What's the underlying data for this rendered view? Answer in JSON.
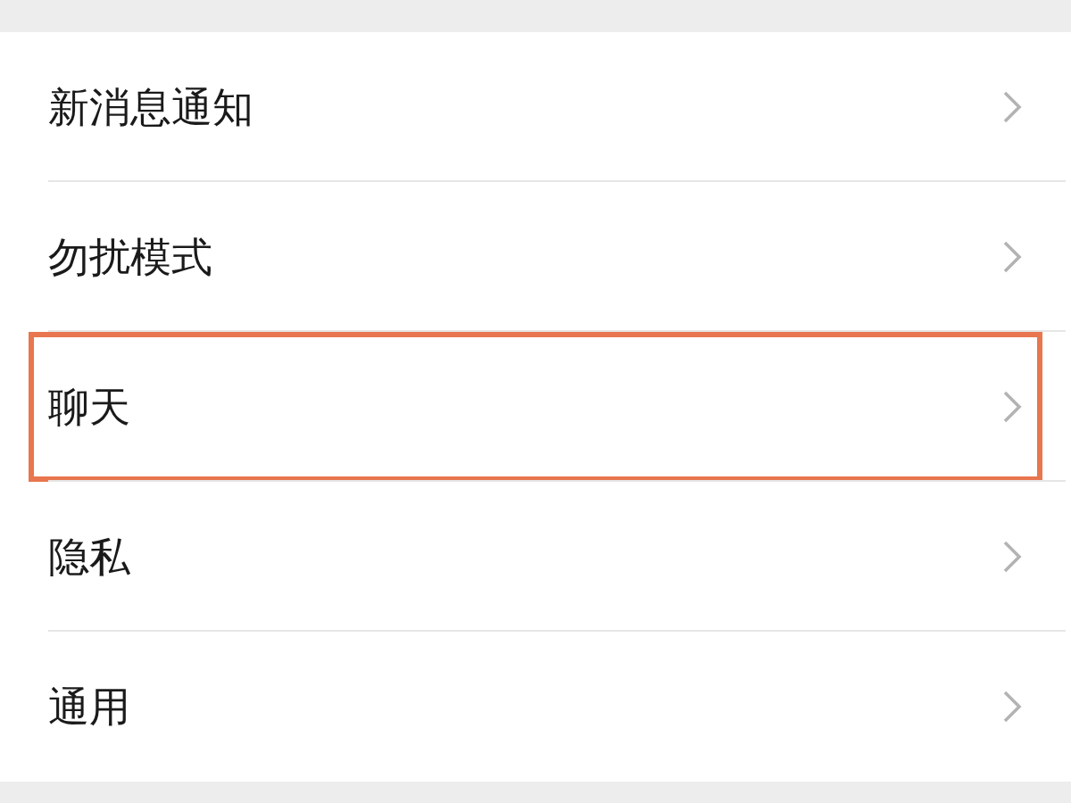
{
  "settings": [
    {
      "label": "新消息通知",
      "highlighted": false
    },
    {
      "label": "勿扰模式",
      "highlighted": false
    },
    {
      "label": "聊天",
      "highlighted": true
    },
    {
      "label": "隐私",
      "highlighted": false
    },
    {
      "label": "通用",
      "highlighted": false
    }
  ]
}
